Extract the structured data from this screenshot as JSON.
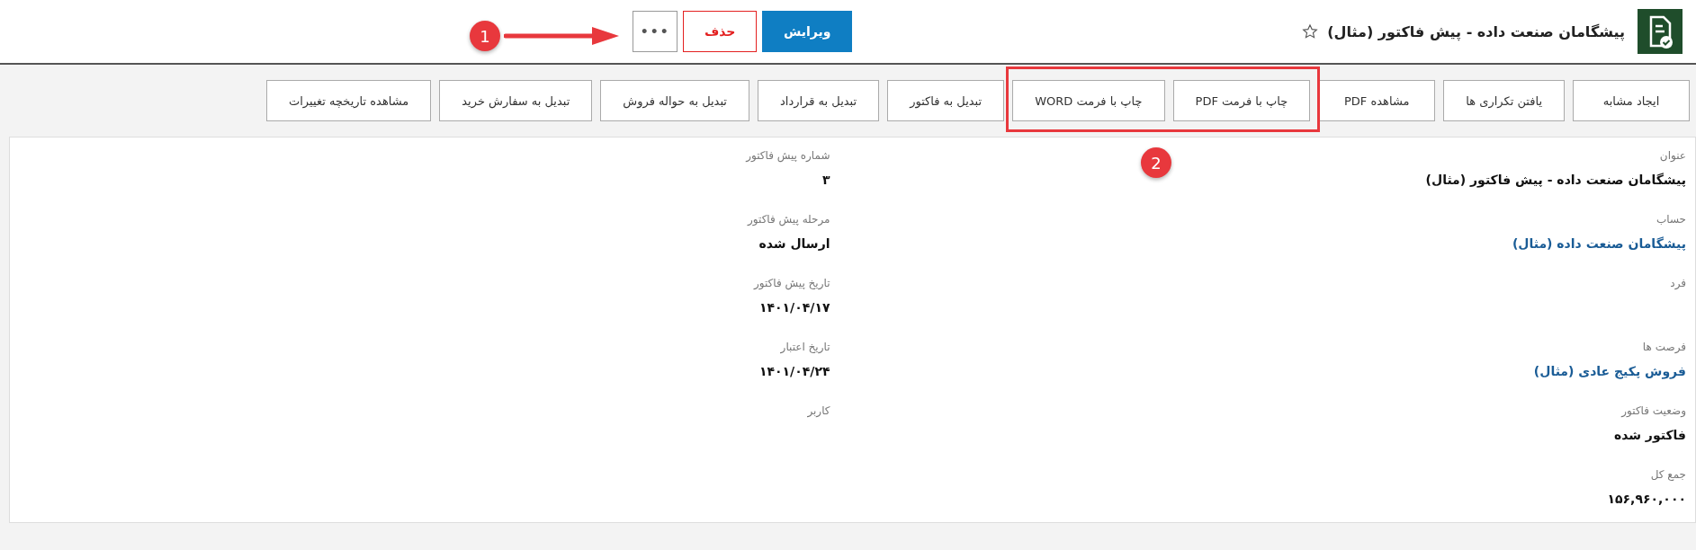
{
  "header": {
    "title": "پیشگامان صنعت داده - پیش فاکتور (مثال)",
    "favorite": false,
    "buttons": [
      {
        "label": "ویرایش",
        "kind": "primary"
      },
      {
        "label": "حذف",
        "kind": "danger"
      },
      {
        "label": "•••",
        "kind": "more"
      }
    ]
  },
  "toolbar": [
    "ایجاد مشابه",
    "یافتن تکراری ها",
    "مشاهده PDF",
    "چاپ با فرمت PDF",
    "چاپ با فرمت WORD",
    "تبدیل به فاکتور",
    "تبدیل به  قرارداد",
    "تبدیل به حواله فروش",
    "تبدیل به سفارش خرید",
    "مشاهده تاریخچه تغییرات"
  ],
  "fields_right": [
    {
      "label": "عنوان",
      "value": "پیشگامان صنعت داده - پیش فاکتور (مثال)",
      "kind": "text"
    },
    {
      "label": "حساب",
      "value": "پیشگامان صنعت داده (مثال)",
      "kind": "link"
    },
    {
      "label": "فرد"
    },
    {
      "label": "فرصت ها",
      "value": "فروش پکیج عادی (مثال)",
      "kind": "link"
    },
    {
      "label": "وضعیت فاکتور",
      "value": "فاکتور شده",
      "kind": "text"
    },
    {
      "label": "جمع کل",
      "value": "۱۵۶,۹۶۰,۰۰۰",
      "kind": "text"
    }
  ],
  "fields_left": [
    {
      "label": "شماره پیش فاکتور",
      "value": "۳"
    },
    {
      "label": "مرحله پیش فاکتور",
      "value": "ارسال شده"
    },
    {
      "label": "تاریخ پیش فاکتور",
      "value": "۱۴۰۱/۰۴/۱۷"
    },
    {
      "label": "تاریخ اعتبار",
      "value": "۱۴۰۱/۰۴/۲۴"
    },
    {
      "label": "کاربر"
    }
  ],
  "annotations": [
    {
      "number": "1"
    },
    {
      "number": "2"
    }
  ]
}
